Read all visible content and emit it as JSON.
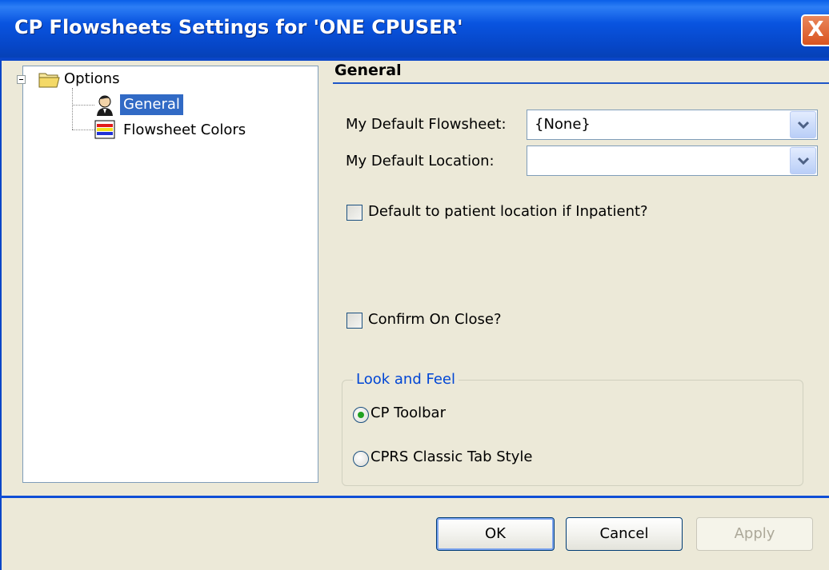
{
  "window": {
    "title": "CP Flowsheets Settings for 'ONE CPUSER'",
    "close_label": "X"
  },
  "tree": {
    "root_label": "Options",
    "items": [
      {
        "label": "General",
        "icon": "person-icon",
        "selected": true
      },
      {
        "label": "Flowsheet Colors",
        "icon": "colors-icon",
        "selected": false
      }
    ]
  },
  "general": {
    "section_title": "General",
    "default_flowsheet_label": "My Default Flowsheet:",
    "default_flowsheet_value": "{None}",
    "default_location_label": "My Default Location:",
    "default_location_value": "",
    "inpatient_checkbox_label": "Default to patient location if Inpatient?",
    "inpatient_checked": false,
    "confirm_close_label": "Confirm On Close?",
    "confirm_close_checked": false,
    "look_and_feel": {
      "caption": "Look and Feel",
      "options": [
        {
          "label": "CP Toolbar",
          "checked": true
        },
        {
          "label": "CPRS Classic Tab Style",
          "checked": false
        }
      ]
    }
  },
  "buttons": {
    "ok": "OK",
    "cancel": "Cancel",
    "apply": "Apply"
  },
  "colors": {
    "titlebar": "#0954E0",
    "selection": "#316AC5",
    "groupbox_caption": "#0046D5",
    "dialog_bg": "#ECE9D8"
  }
}
